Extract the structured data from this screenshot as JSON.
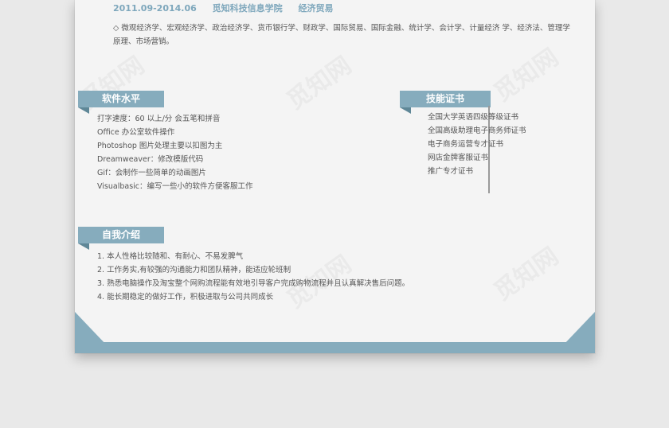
{
  "education": {
    "period": "2011.09-2014.06",
    "school": "觅知科技信息学院",
    "major": "经济贸易"
  },
  "courses": "◇  微观经济学、宏观经济学、政治经济学、货币银行学、财政学、国际贸易、国际金融、统计学、会计学、计量经济 学、经济法、管理学原理、市场营销。",
  "software": {
    "title": "软件水平",
    "items": [
      "打字速度：60 以上/分  会五笔和拼音",
      "Office 办公室软件操作",
      "Photoshop 图片处理主要以扣图为主",
      "Dreamweaver：修改模版代码",
      "Gif：会制作一些简单的动画图片",
      "Visualbasic：编写一些小的软件方便客服工作"
    ]
  },
  "certificates": {
    "title": "技能证书",
    "items": [
      "全国大学英语四级等级证书",
      "全国高级助理电子商务师证书",
      "电子商务运营专才证书",
      "网店金牌客服证书",
      "推广专才证书"
    ]
  },
  "about": {
    "title": "自我介绍",
    "items": [
      "1. 本人性格比较随和、有耐心、不易发脾气",
      "2. 工作务实,有较强的沟通能力和团队精神，能适应轮班制",
      "3. 熟悉电脑操作及淘宝整个网购流程能有效地引导客户完成购物流程并且认真解决售后问题。",
      "4. 能长期稳定的做好工作，积极进取与公司共同成长"
    ]
  },
  "watermark": "觅知网",
  "colors": {
    "accent": "#86acbd",
    "accent_dark": "#5f8797",
    "text": "#555555"
  }
}
